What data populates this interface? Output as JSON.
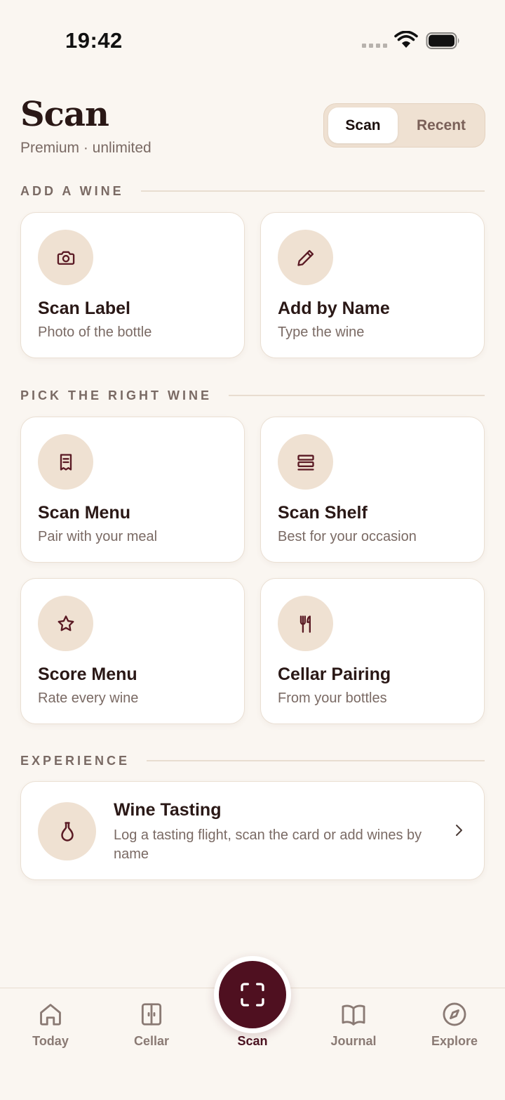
{
  "status_bar": {
    "time": "19:42"
  },
  "header": {
    "title": "Scan",
    "subtitle": "Premium · unlimited",
    "segments": [
      {
        "label": "Scan",
        "active": true
      },
      {
        "label": "Recent",
        "active": false
      }
    ]
  },
  "sections": {
    "add": "ADD A WINE",
    "pick": "PICK THE RIGHT WINE",
    "experience": "EXPERIENCE"
  },
  "tiles": [
    {
      "title": "Scan Label",
      "subtitle": "Photo of the bottle",
      "icon": "camera-icon"
    },
    {
      "title": "Add by Name",
      "subtitle": "Type the wine",
      "icon": "pencil-icon"
    },
    {
      "title": "Scan Menu",
      "subtitle": "Pair with your meal",
      "icon": "receipt-icon"
    },
    {
      "title": "Scan Shelf",
      "subtitle": "Best for your occasion",
      "icon": "shelf-icon"
    },
    {
      "title": "Score Menu",
      "subtitle": "Rate every wine",
      "icon": "star-icon"
    },
    {
      "title": "Cellar Pairing",
      "subtitle": "From your bottles",
      "icon": "fork-knife-icon"
    }
  ],
  "experience_card": {
    "title": "Wine Tasting",
    "subtitle": "Log a tasting flight, scan the card or add wines by name",
    "icon": "carafe-icon"
  },
  "tab_bar": {
    "items": [
      {
        "label": "Today",
        "icon": "home-icon"
      },
      {
        "label": "Cellar",
        "icon": "cellar-icon"
      },
      {
        "label": "Scan",
        "icon": "scan-frame-icon",
        "active": true
      },
      {
        "label": "Journal",
        "icon": "book-icon"
      },
      {
        "label": "Explore",
        "icon": "compass-icon"
      }
    ]
  },
  "colors": {
    "background": "#faf6f1",
    "accent": "#4f1020",
    "icon_circle": "#efe1d2",
    "text_primary": "#2a1816",
    "text_secondary": "#7a6a64"
  }
}
